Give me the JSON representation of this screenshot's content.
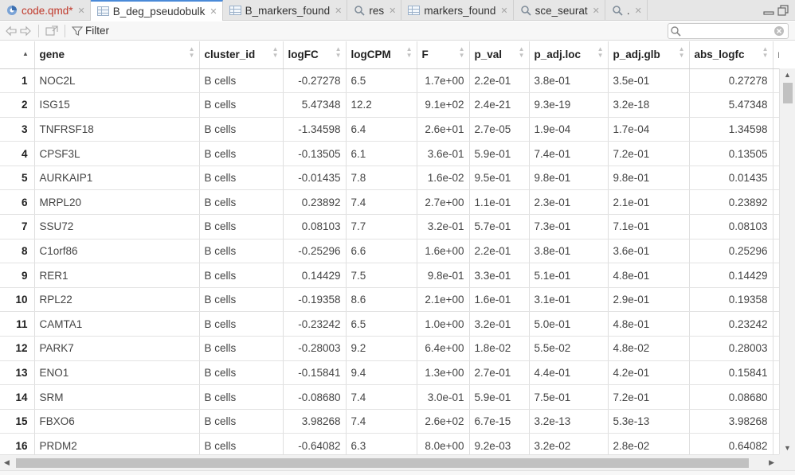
{
  "tabs": [
    {
      "label": "code.qmd*",
      "icon": "quarto-doc-icon",
      "active": false,
      "modified": true
    },
    {
      "label": "B_deg_pseudobulk",
      "icon": "data-grid-icon",
      "active": true
    },
    {
      "label": "B_markers_found",
      "icon": "data-grid-icon",
      "active": false
    },
    {
      "label": "res",
      "icon": "magnifier-icon",
      "active": false
    },
    {
      "label": "markers_found",
      "icon": "data-grid-icon",
      "active": false
    },
    {
      "label": "sce_seurat",
      "icon": "magnifier-icon",
      "active": false
    },
    {
      "label": ".",
      "icon": "magnifier-icon",
      "active": false
    }
  ],
  "toolbar": {
    "filter_label": "Filter"
  },
  "table": {
    "columns": [
      "gene",
      "cluster_id",
      "logFC",
      "logCPM",
      "F",
      "p_val",
      "p_adj.loc",
      "p_adj.glb",
      "abs_logfc",
      "reg"
    ],
    "rows": [
      [
        "1",
        "NOC2L",
        "B cells",
        "-0.27278",
        "6.5",
        "1.7e+00",
        "2.2e-01",
        "3.8e-01",
        "3.5e-01",
        "0.27278"
      ],
      [
        "2",
        "ISG15",
        "B cells",
        "5.47348",
        "12.2",
        "9.1e+02",
        "2.4e-21",
        "9.3e-19",
        "3.2e-18",
        "5.47348"
      ],
      [
        "3",
        "TNFRSF18",
        "B cells",
        "-1.34598",
        "6.4",
        "2.6e+01",
        "2.7e-05",
        "1.9e-04",
        "1.7e-04",
        "1.34598"
      ],
      [
        "4",
        "CPSF3L",
        "B cells",
        "-0.13505",
        "6.1",
        "3.6e-01",
        "5.9e-01",
        "7.4e-01",
        "7.2e-01",
        "0.13505"
      ],
      [
        "5",
        "AURKAIP1",
        "B cells",
        "-0.01435",
        "7.8",
        "1.6e-02",
        "9.5e-01",
        "9.8e-01",
        "9.8e-01",
        "0.01435"
      ],
      [
        "6",
        "MRPL20",
        "B cells",
        "0.23892",
        "7.4",
        "2.7e+00",
        "1.1e-01",
        "2.3e-01",
        "2.1e-01",
        "0.23892"
      ],
      [
        "7",
        "SSU72",
        "B cells",
        "0.08103",
        "7.7",
        "3.2e-01",
        "5.7e-01",
        "7.3e-01",
        "7.1e-01",
        "0.08103"
      ],
      [
        "8",
        "C1orf86",
        "B cells",
        "-0.25296",
        "6.6",
        "1.6e+00",
        "2.2e-01",
        "3.8e-01",
        "3.6e-01",
        "0.25296"
      ],
      [
        "9",
        "RER1",
        "B cells",
        "0.14429",
        "7.5",
        "9.8e-01",
        "3.3e-01",
        "5.1e-01",
        "4.8e-01",
        "0.14429"
      ],
      [
        "10",
        "RPL22",
        "B cells",
        "-0.19358",
        "8.6",
        "2.1e+00",
        "1.6e-01",
        "3.1e-01",
        "2.9e-01",
        "0.19358"
      ],
      [
        "11",
        "CAMTA1",
        "B cells",
        "-0.23242",
        "6.5",
        "1.0e+00",
        "3.2e-01",
        "5.0e-01",
        "4.8e-01",
        "0.23242"
      ],
      [
        "12",
        "PARK7",
        "B cells",
        "-0.28003",
        "9.2",
        "6.4e+00",
        "1.8e-02",
        "5.5e-02",
        "4.8e-02",
        "0.28003"
      ],
      [
        "13",
        "ENO1",
        "B cells",
        "-0.15841",
        "9.4",
        "1.3e+00",
        "2.7e-01",
        "4.4e-01",
        "4.2e-01",
        "0.15841"
      ],
      [
        "14",
        "SRM",
        "B cells",
        "-0.08680",
        "7.4",
        "3.0e-01",
        "5.9e-01",
        "7.5e-01",
        "7.2e-01",
        "0.08680"
      ],
      [
        "15",
        "FBXO6",
        "B cells",
        "3.98268",
        "7.4",
        "2.6e+02",
        "6.7e-15",
        "3.2e-13",
        "5.3e-13",
        "3.98268"
      ],
      [
        "16",
        "PRDM2",
        "B cells",
        "-0.64082",
        "6.3",
        "8.0e+00",
        "9.2e-03",
        "3.2e-02",
        "2.8e-02",
        "0.64082"
      ]
    ]
  },
  "colors": {
    "accent": "#4a8ad8",
    "tab_bg": "#e6e6e6",
    "grid_line": "#dedede"
  }
}
